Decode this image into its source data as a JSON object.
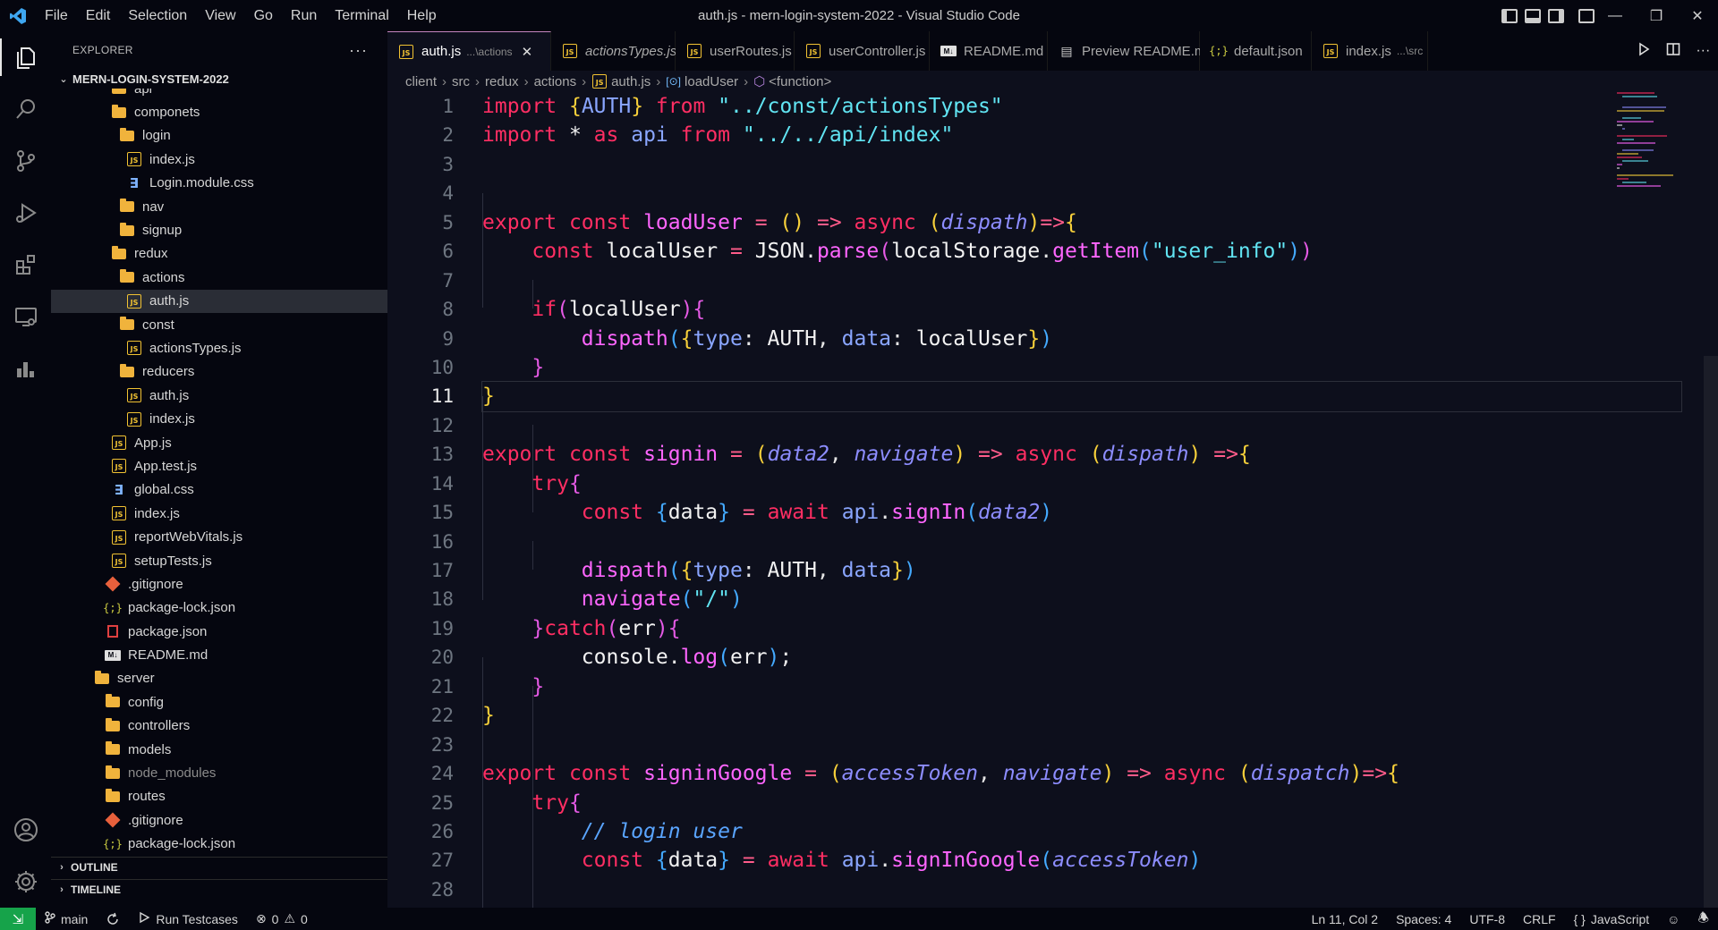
{
  "menu": [
    "File",
    "Edit",
    "Selection",
    "View",
    "Go",
    "Run",
    "Terminal",
    "Help"
  ],
  "window_title": "auth.js - mern-login-system-2022 - Visual Studio Code",
  "explorer": {
    "header": "EXPLORER",
    "more": "···",
    "project": "MERN-LOGIN-SYSTEM-2022",
    "tree": [
      {
        "label": "api",
        "type": "folder",
        "indent": 2
      },
      {
        "label": "componets",
        "type": "folder",
        "indent": 2
      },
      {
        "label": "login",
        "type": "folder",
        "indent": 3
      },
      {
        "label": "index.js",
        "type": "js",
        "indent": 4
      },
      {
        "label": "Login.module.css",
        "type": "css",
        "indent": 4
      },
      {
        "label": "nav",
        "type": "folder",
        "indent": 3
      },
      {
        "label": "signup",
        "type": "folder",
        "indent": 3
      },
      {
        "label": "redux",
        "type": "folder",
        "indent": 2
      },
      {
        "label": "actions",
        "type": "folder",
        "indent": 3
      },
      {
        "label": "auth.js",
        "type": "js",
        "indent": 4,
        "selected": true
      },
      {
        "label": "const",
        "type": "folder",
        "indent": 3
      },
      {
        "label": "actionsTypes.js",
        "type": "js",
        "indent": 4
      },
      {
        "label": "reducers",
        "type": "folder",
        "indent": 3
      },
      {
        "label": "auth.js",
        "type": "js",
        "indent": 4
      },
      {
        "label": "index.js",
        "type": "js",
        "indent": 4
      },
      {
        "label": "App.js",
        "type": "js",
        "indent": 2
      },
      {
        "label": "App.test.js",
        "type": "js",
        "indent": 2
      },
      {
        "label": "global.css",
        "type": "css",
        "indent": 2
      },
      {
        "label": "index.js",
        "type": "js",
        "indent": 2
      },
      {
        "label": "reportWebVitals.js",
        "type": "js",
        "indent": 2
      },
      {
        "label": "setupTests.js",
        "type": "js",
        "indent": 2
      },
      {
        "label": ".gitignore",
        "type": "git",
        "indent": 1
      },
      {
        "label": "package-lock.json",
        "type": "json",
        "indent": 1
      },
      {
        "label": "package.json",
        "type": "pkg",
        "indent": 1
      },
      {
        "label": "README.md",
        "type": "md",
        "indent": 1
      },
      {
        "label": "server",
        "type": "folder",
        "indent": 0
      },
      {
        "label": "config",
        "type": "folder",
        "indent": 1
      },
      {
        "label": "controllers",
        "type": "folder",
        "indent": 1
      },
      {
        "label": "models",
        "type": "folder",
        "indent": 1
      },
      {
        "label": "node_modules",
        "type": "folder",
        "indent": 1,
        "dim": true
      },
      {
        "label": "routes",
        "type": "folder",
        "indent": 1
      },
      {
        "label": ".gitignore",
        "type": "git",
        "indent": 1
      },
      {
        "label": "package-lock.json",
        "type": "json",
        "indent": 1
      }
    ],
    "outline": "OUTLINE",
    "timeline": "TIMELINE"
  },
  "tabs": [
    {
      "label": "auth.js",
      "desc": "...\\actions",
      "icon": "js",
      "active": true,
      "close": "✕"
    },
    {
      "label": "actionsTypes.js",
      "icon": "js",
      "italic": true
    },
    {
      "label": "userRoutes.js",
      "icon": "js"
    },
    {
      "label": "userController.js",
      "icon": "js"
    },
    {
      "label": "README.md",
      "icon": "md"
    },
    {
      "label": "Preview README.md",
      "icon": "preview"
    },
    {
      "label": "default.json",
      "icon": "json"
    },
    {
      "label": "index.js",
      "desc": "...\\src",
      "icon": "js"
    }
  ],
  "breadcrumb": [
    "client",
    "src",
    "redux",
    "actions",
    "auth.js",
    "loadUser",
    "<function>"
  ],
  "current_line": 11,
  "status": {
    "branch": "main",
    "run_testcases": "Run Testcases",
    "errors": "0",
    "warnings": "0",
    "cursor": "Ln 11, Col 2",
    "spaces": "Spaces: 4",
    "encoding": "UTF-8",
    "eol": "CRLF",
    "language": "JavaScript"
  },
  "colors": {
    "background": "#0d0f1c",
    "keyword": "#ff2e63",
    "string": "#61e4f2",
    "function": "#ff66ff",
    "bracket": "#f7d03a",
    "remote": "#16a34a"
  }
}
